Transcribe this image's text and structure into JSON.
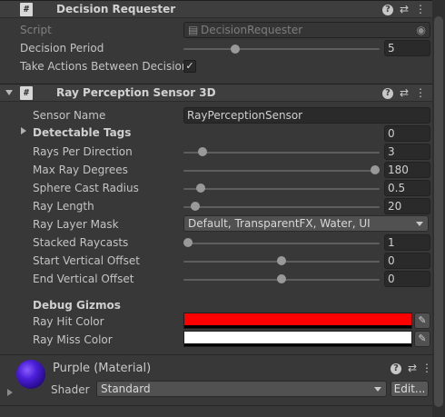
{
  "decision_requester": {
    "title": "Decision Requester",
    "script_label": "Script",
    "script_value": "DecisionRequester",
    "period_label": "Decision Period",
    "period_value": "5",
    "period_slider_fraction": 0.25,
    "take_actions_label": "Take Actions Between Decision",
    "take_actions_checked": "✓"
  },
  "ray_sensor": {
    "title": "Ray Perception Sensor 3D",
    "sensor_name_label": "Sensor Name",
    "sensor_name_value": "RayPerceptionSensor",
    "detectable_tags_label": "Detectable Tags",
    "detectable_tags_value": "0",
    "rays_label": "Rays Per Direction",
    "rays_value": "3",
    "rays_fraction": 0.08,
    "max_deg_label": "Max Ray Degrees",
    "max_deg_value": "180",
    "max_deg_fraction": 1.0,
    "sphere_label": "Sphere Cast Radius",
    "sphere_value": "0.5",
    "sphere_fraction": 0.07,
    "length_label": "Ray Length",
    "length_value": "20",
    "length_fraction": 0.04,
    "layer_mask_label": "Ray Layer Mask",
    "layer_mask_value": "Default, TransparentFX, Water, UI",
    "stacked_label": "Stacked Raycasts",
    "stacked_value": "1",
    "stacked_fraction": 0.0,
    "start_offset_label": "Start Vertical Offset",
    "start_offset_value": "0",
    "start_offset_fraction": 0.5,
    "end_offset_label": "End Vertical Offset",
    "end_offset_value": "0",
    "end_offset_fraction": 0.5,
    "debug_label": "Debug Gizmos",
    "hit_color_label": "Ray Hit Color",
    "hit_color": "#ff0000",
    "miss_color_label": "Ray Miss Color",
    "miss_color": "#ffffff"
  },
  "material": {
    "title": "Purple (Material)",
    "shader_label": "Shader",
    "shader_value": "Standard",
    "edit_label": "Edit..."
  },
  "icons": {
    "help": "?",
    "preset": "⇄",
    "menu": "⋮",
    "script": "#",
    "picker": "✎",
    "target": "◉"
  }
}
